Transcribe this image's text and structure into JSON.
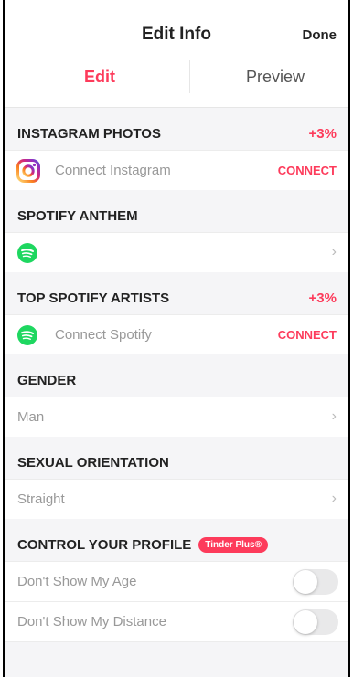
{
  "nav": {
    "title": "Edit Info",
    "done_label": "Done"
  },
  "tabs": {
    "edit": "Edit",
    "preview": "Preview"
  },
  "instagram": {
    "header": "INSTAGRAM PHOTOS",
    "boost": "+3%",
    "row_label": "Connect Instagram",
    "connect_label": "CONNECT"
  },
  "anthem": {
    "header": "SPOTIFY ANTHEM",
    "chevron": "›"
  },
  "top_artists": {
    "header": "TOP SPOTIFY ARTISTS",
    "boost": "+3%",
    "row_label": "Connect Spotify",
    "connect_label": "CONNECT"
  },
  "gender": {
    "header": "GENDER",
    "value": "Man",
    "chevron": "›"
  },
  "orientation": {
    "header": "SEXUAL ORIENTATION",
    "value": "Straight",
    "chevron": "›"
  },
  "control": {
    "header": "CONTROL YOUR PROFILE",
    "badge": "Tinder Plus®",
    "toggles": [
      {
        "label": "Don't Show My Age",
        "on": false
      },
      {
        "label": "Don't Show My Distance",
        "on": false
      }
    ]
  },
  "colors": {
    "accent": "#fd3b5b",
    "spotify": "#1ed760",
    "background": "#f5f5f7"
  },
  "icons": {
    "instagram": "instagram-icon",
    "spotify": "spotify-icon"
  }
}
